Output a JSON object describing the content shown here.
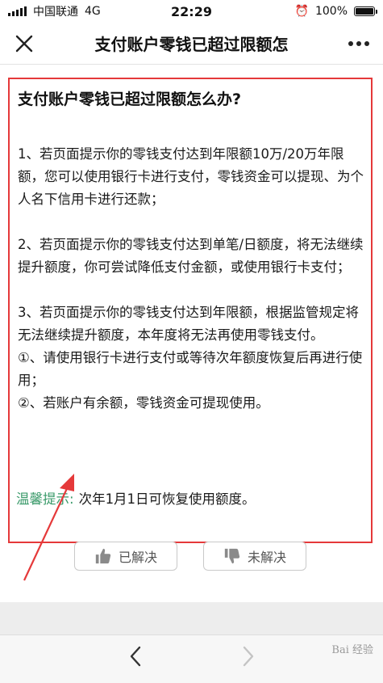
{
  "status_bar": {
    "carrier": "中国联通",
    "network": "4G",
    "time": "22:29",
    "battery_text": "100%",
    "battery_level": 1.0
  },
  "nav": {
    "title": "支付账户零钱已超过限额怎",
    "close_icon": "close-icon",
    "more_icon": "more-icon"
  },
  "answer": {
    "title": "支付账户零钱已超过限额怎么办?",
    "para1": "1、若页面提示你的零钱支付达到年限额10万/20万年限额，您可以使用银行卡进行支付，零钱资金可以提现、为个人名下信用卡进行还款；",
    "para2": "2、若页面提示你的零钱支付达到单笔/日额度，将无法继续提升额度，你可尝试降低支付金额，或使用银行卡支付；",
    "para3": "3、若页面提示你的零钱支付达到年限额，根据监管规定将无法继续提升额度，本年度将无法再使用零钱支付。",
    "line4": "①、请使用银行卡进行支付或等待次年额度恢复后再进行使用；",
    "line5": "②、若账户有余额，零钱资金可提现使用。"
  },
  "tip": {
    "label": "温馨提示:",
    "text": "次年1月1日可恢复使用额度。"
  },
  "feedback": {
    "resolved_label": "已解决",
    "unresolved_label": "未解决"
  },
  "colors": {
    "highlight_border": "#e5393a",
    "tip_label": "#3a9a6a"
  },
  "toolbar": {
    "back_icon": "chevron-left-icon",
    "forward_icon": "chevron-right-icon"
  },
  "watermark": {
    "text": "Bai 经验"
  }
}
